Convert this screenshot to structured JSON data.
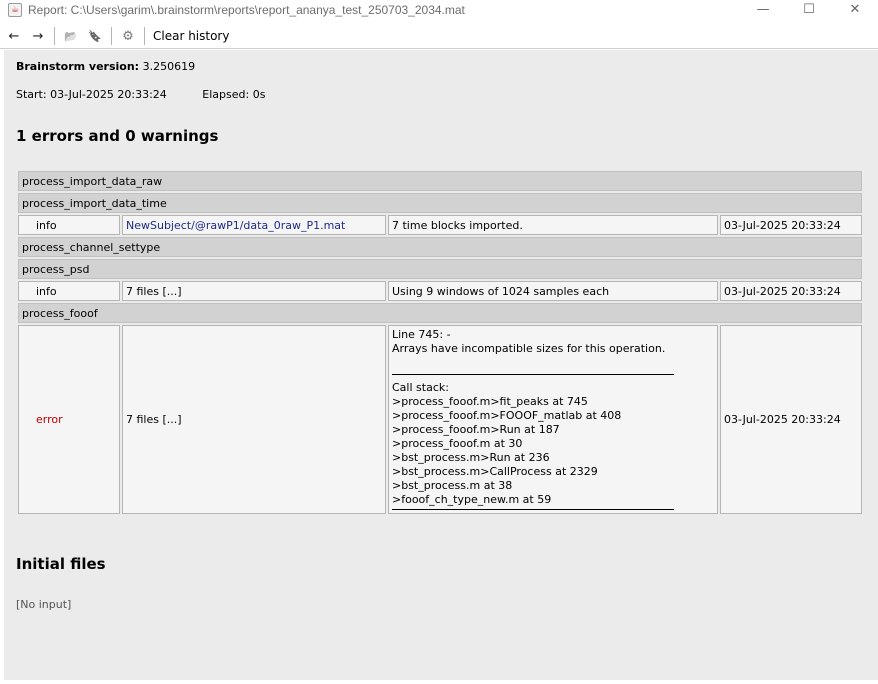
{
  "window": {
    "title": "Report: C:\\Users\\garim\\.brainstorm\\reports\\report_ananya_test_250703_2034.mat",
    "minimize": "—",
    "maximize": "☐",
    "close": "✕"
  },
  "toolbar": {
    "back": "←",
    "forward": "→",
    "open": "📂",
    "save": "🔖",
    "settings": "⚙",
    "clear_history": "Clear history"
  },
  "header": {
    "version_label": "Brainstorm version:",
    "version_value": "3.250619",
    "start": "Start: 03-Jul-2025 20:33:24",
    "elapsed": "Elapsed: 0s"
  },
  "summary": "1 errors and 0 warnings",
  "rows": {
    "p1": "process_import_data_raw",
    "p2": "process_import_data_time",
    "r1": {
      "type": "info",
      "file": "NewSubject/@rawP1/data_0raw_P1.mat",
      "msg": "7 time blocks imported.",
      "date": "03-Jul-2025 20:33:24"
    },
    "p3": "process_channel_settype",
    "p4": "process_psd",
    "r2": {
      "type": "info",
      "file": "7 files [...]",
      "msg": "Using 9 windows of 1024 samples each",
      "date": "03-Jul-2025 20:33:24"
    },
    "p5": "process_fooof",
    "r3": {
      "type": "error",
      "file": "7 files [...]",
      "line1": "Line 745: -",
      "line2": "Arrays have incompatible sizes for this operation.",
      "stack_label": "Call stack:",
      "s1": ">process_fooof.m>fit_peaks at 745",
      "s2": ">process_fooof.m>FOOOF_matlab at 408",
      "s3": ">process_fooof.m>Run at 187",
      "s4": ">process_fooof.m at 30",
      "s5": ">bst_process.m>Run at 236",
      "s6": ">bst_process.m>CallProcess at 2329",
      "s7": ">bst_process.m at 38",
      "s8": ">fooof_ch_type_new.m at 59",
      "date": "03-Jul-2025 20:33:24"
    }
  },
  "initial_files": {
    "heading": "Initial files",
    "none": "[No input]"
  }
}
